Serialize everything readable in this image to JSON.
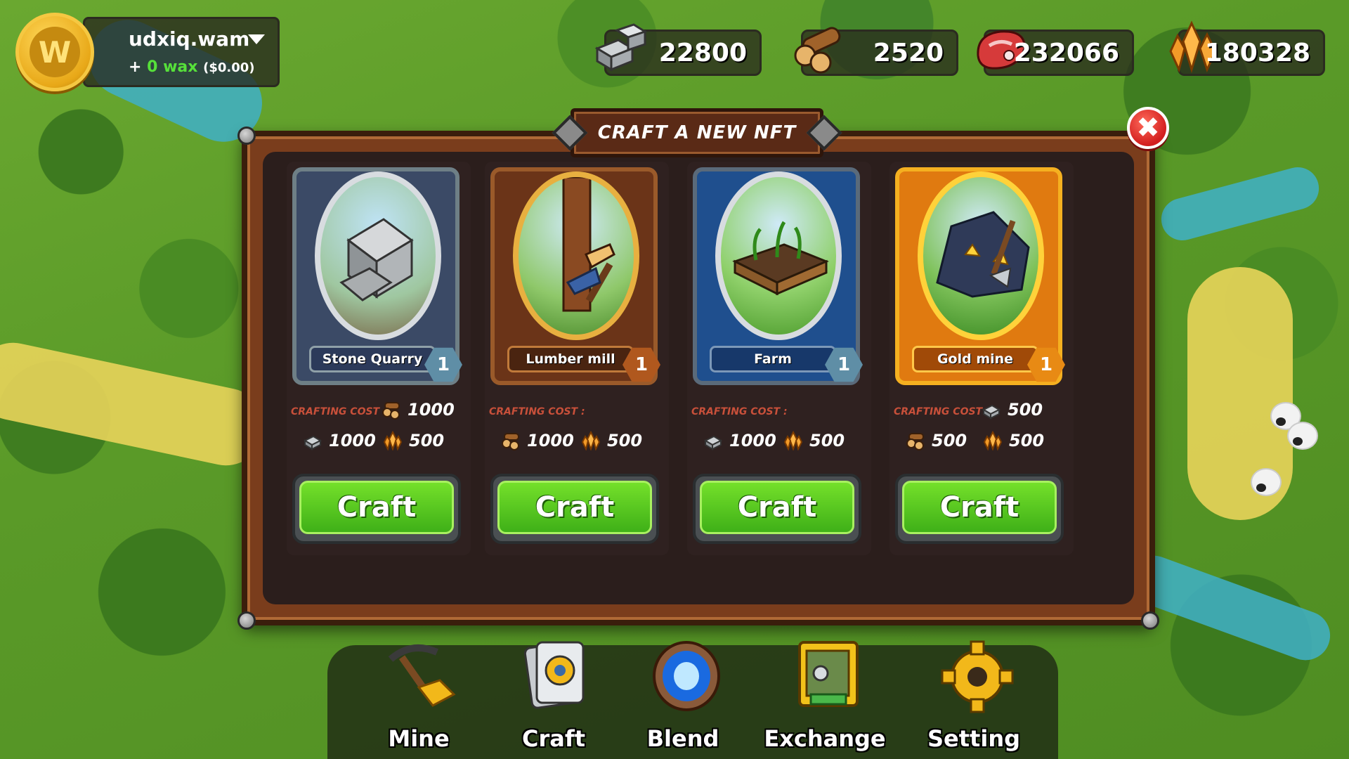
{
  "wallet": {
    "account": "udxiq.wam",
    "prefix": "+",
    "wax_amount": "0 wax",
    "wax_usd": "($0.00)",
    "coin_letter": "W"
  },
  "resources": [
    {
      "name": "stone",
      "value": "22800"
    },
    {
      "name": "wood",
      "value": "2520"
    },
    {
      "name": "food",
      "value": "232066"
    },
    {
      "name": "gold",
      "value": "180328"
    }
  ],
  "modal": {
    "title": "CRAFT A NEW NFT",
    "close_glyph": "✖"
  },
  "cards": [
    {
      "name": "Stone Quarry",
      "level": "1",
      "rarity_color": "#6e7f86",
      "cost_label": "CRAFTING COST :",
      "costs": [
        {
          "resource": "wood",
          "amount": "1000"
        },
        {
          "resource": "stone",
          "amount": "1000"
        },
        {
          "resource": "gold",
          "amount": "500"
        }
      ],
      "button": "Craft"
    },
    {
      "name": "Lumber mill",
      "level": "1",
      "rarity_color": "#9a5a2a",
      "cost_label": "CRAFTING COST :",
      "costs": [
        {
          "resource": "wood",
          "amount": "1000"
        },
        {
          "resource": "gold",
          "amount": "500"
        }
      ],
      "button": "Craft"
    },
    {
      "name": "Farm",
      "level": "1",
      "rarity_color": "#1f4f8e",
      "cost_label": "CRAFTING COST :",
      "costs": [
        {
          "resource": "stone",
          "amount": "1000"
        },
        {
          "resource": "gold",
          "amount": "500"
        }
      ],
      "button": "Craft"
    },
    {
      "name": "Gold mine",
      "level": "1",
      "rarity_color": "#e89a10",
      "cost_label": "CRAFTING COST :",
      "costs": [
        {
          "resource": "stone",
          "amount": "500"
        },
        {
          "resource": "wood",
          "amount": "500"
        },
        {
          "resource": "gold",
          "amount": "500"
        }
      ],
      "button": "Craft"
    }
  ],
  "menu": [
    {
      "label": "Mine",
      "icon": "pickaxe-icon"
    },
    {
      "label": "Craft",
      "icon": "cards-icon"
    },
    {
      "label": "Blend",
      "icon": "portal-icon"
    },
    {
      "label": "Exchange",
      "icon": "vault-icon"
    },
    {
      "label": "Setting",
      "icon": "gear-icon"
    }
  ]
}
